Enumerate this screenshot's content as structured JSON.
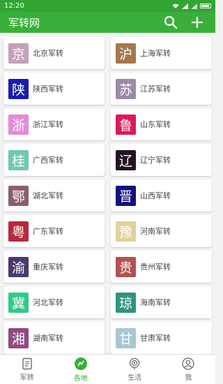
{
  "status": {
    "time": "12:20"
  },
  "app": {
    "title": "军转网"
  },
  "regions": [
    {
      "char": "京",
      "label": "北京军转",
      "color": "#c6a0b8"
    },
    {
      "char": "沪",
      "label": "上海军转",
      "color": "#a4784e"
    },
    {
      "char": "陕",
      "label": "陕西军转",
      "color": "#1a1dac"
    },
    {
      "char": "苏",
      "label": "江苏军转",
      "color": "#9b8aa8"
    },
    {
      "char": "浙",
      "label": "浙江军转",
      "color": "#e38ad9"
    },
    {
      "char": "鲁",
      "label": "山东军转",
      "color": "#d81c57"
    },
    {
      "char": "桂",
      "label": "广西军转",
      "color": "#6ec8b1"
    },
    {
      "char": "辽",
      "label": "辽宁军转",
      "color": "#221522"
    },
    {
      "char": "鄂",
      "label": "湖北军转",
      "color": "#8b5e6d"
    },
    {
      "char": "晋",
      "label": "山西军转",
      "color": "#14117f"
    },
    {
      "char": "粤",
      "label": "广东军转",
      "color": "#b7293b"
    },
    {
      "char": "豫",
      "label": "河南军转",
      "color": "#e2d19a"
    },
    {
      "char": "渝",
      "label": "重庆军转",
      "color": "#4a3a6e"
    },
    {
      "char": "贵",
      "label": "贵州军转",
      "color": "#b4504f"
    },
    {
      "char": "冀",
      "label": "河北军转",
      "color": "#33c98c"
    },
    {
      "char": "琼",
      "label": "海南军转",
      "color": "#2e9480"
    },
    {
      "char": "湘",
      "label": "湖南军转",
      "color": "#8f4a82"
    },
    {
      "char": "甘",
      "label": "甘肃军转",
      "color": "#a7c7d3"
    }
  ],
  "nav": {
    "items": [
      {
        "label": "军转",
        "icon": "document-icon"
      },
      {
        "label": "各地",
        "icon": "region-icon"
      },
      {
        "label": "生活",
        "icon": "radio-icon"
      },
      {
        "label": "我",
        "icon": "profile-icon"
      }
    ],
    "active_index": 1,
    "active_color": "#3aae3a"
  }
}
